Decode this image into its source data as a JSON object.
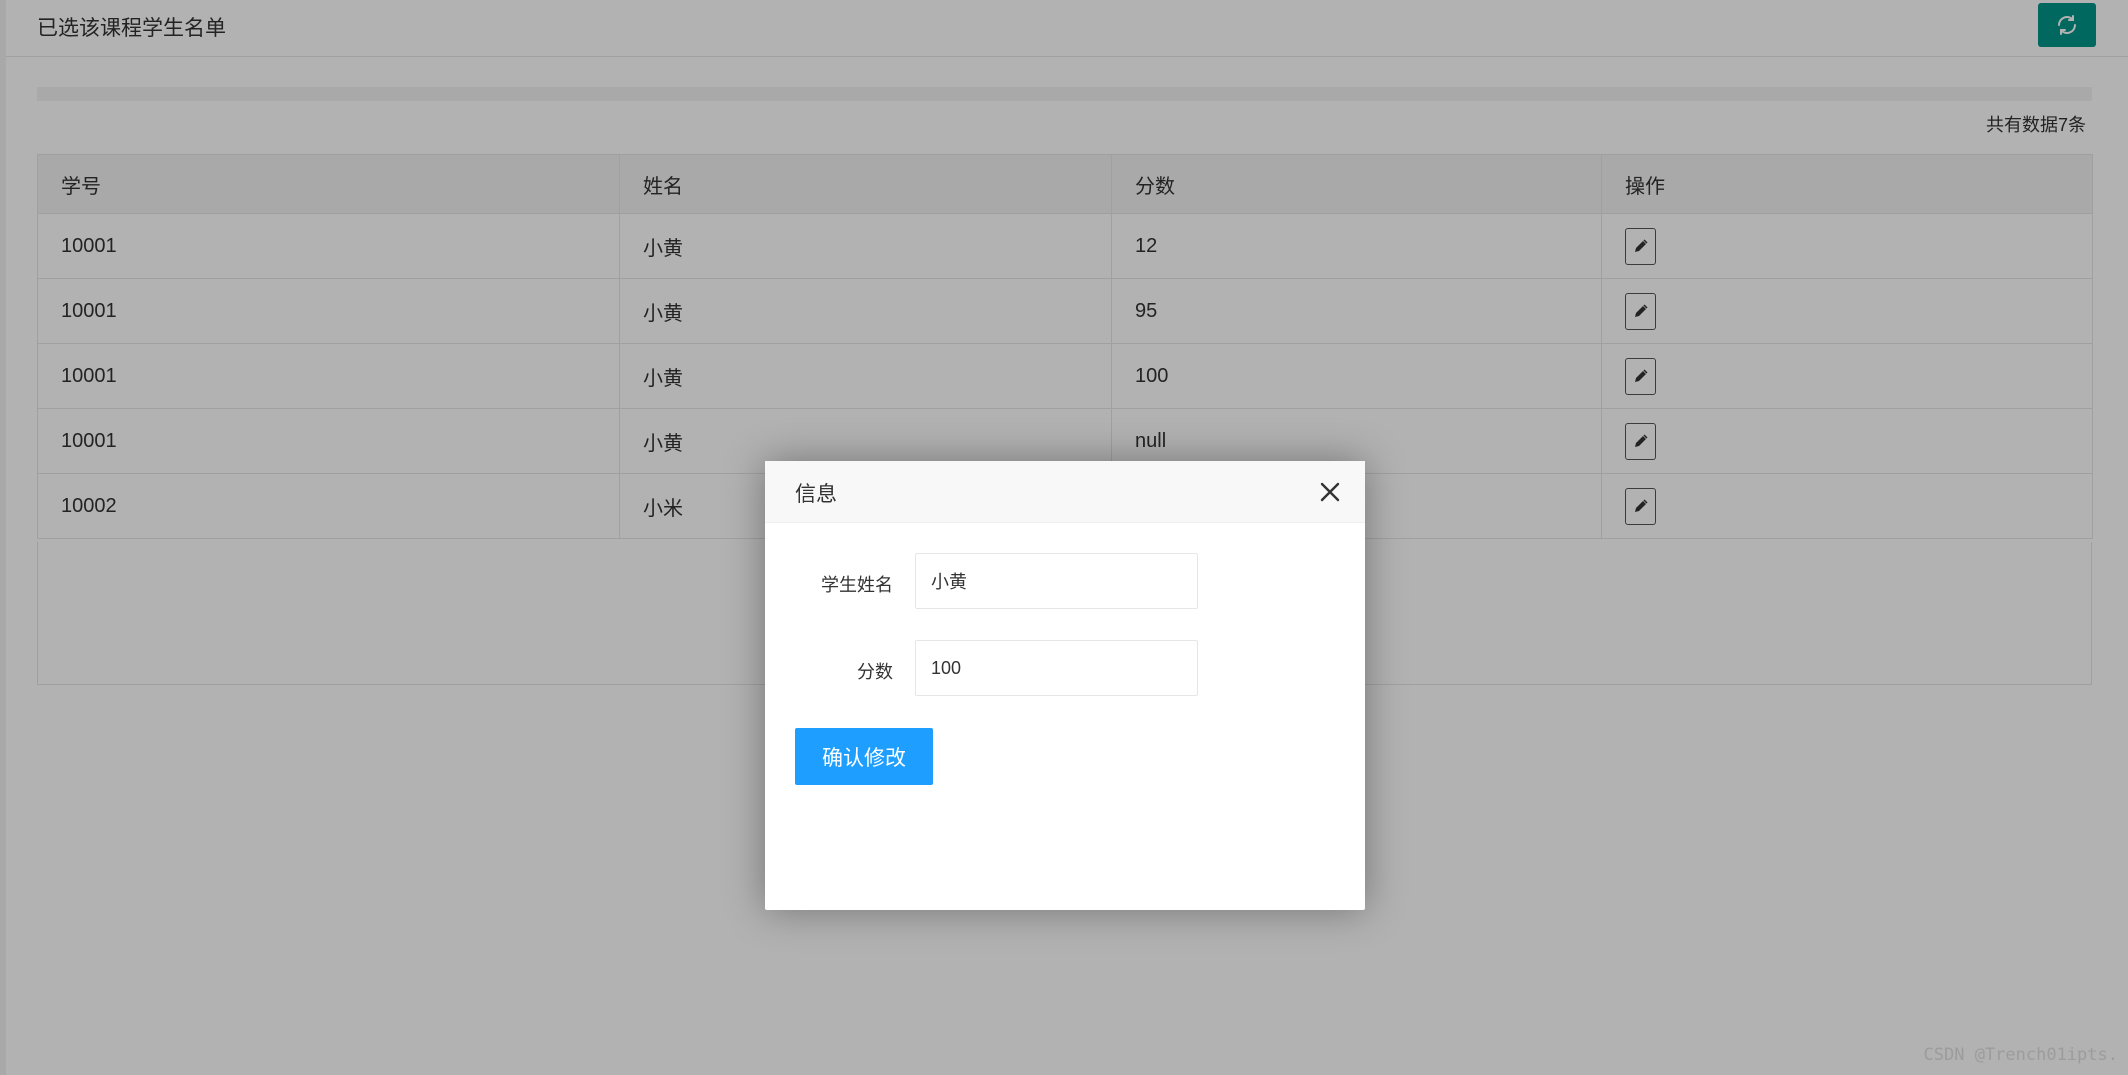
{
  "header": {
    "title": "已选该课程学生名单",
    "refresh_icon": "refresh-icon"
  },
  "table": {
    "total_text": "共有数据7条",
    "columns": [
      "学号",
      "姓名",
      "分数",
      "操作"
    ],
    "rows": [
      {
        "id": "10001",
        "name": "小黄",
        "score": "12"
      },
      {
        "id": "10001",
        "name": "小黄",
        "score": "95"
      },
      {
        "id": "10001",
        "name": "小黄",
        "score": "100"
      },
      {
        "id": "10001",
        "name": "小黄",
        "score": "null"
      },
      {
        "id": "10002",
        "name": "小米",
        "score": ""
      }
    ],
    "edit_icon": "pencil-icon"
  },
  "dialog": {
    "title": "信息",
    "name_label": "学生姓名",
    "name_value": "小黄",
    "score_label": "分数",
    "score_value": "100",
    "confirm_label": "确认修改"
  },
  "watermark": "CSDN @Trench01ipts.",
  "colors": {
    "primary": "#009688",
    "confirm": "#1e9fff"
  }
}
